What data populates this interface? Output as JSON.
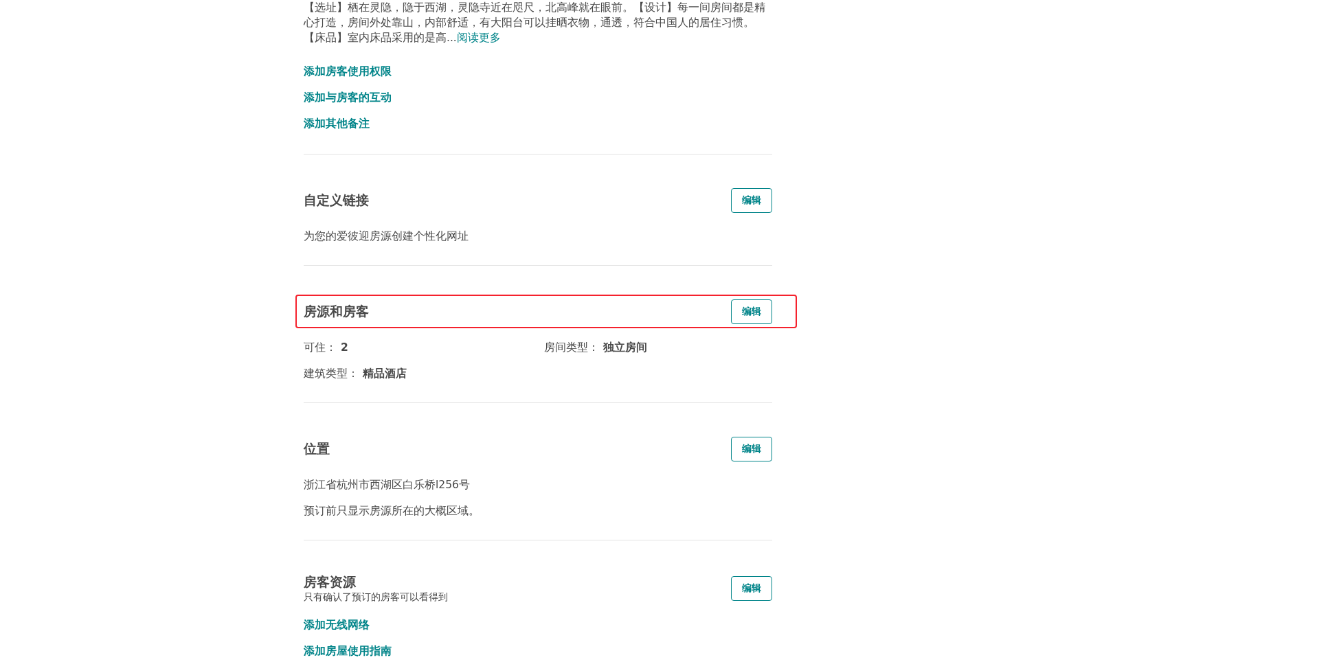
{
  "intro": {
    "paragraph": "【选址】栖在灵隐，隐于西湖，灵隐寺近在咫尺，北高峰就在眼前。【设计】每一间房间都是精心打造，房间外处靠山，内部舒适，有大阳台可以挂晒衣物，通透，符合中国人的居住习惯。【床品】室内床品采用的是高...",
    "read_more": "阅读更多",
    "links": [
      "添加房客使用权限",
      "添加与房客的互动",
      "添加其他备注"
    ]
  },
  "sections": [
    {
      "title": "自定义链接",
      "button": "编辑",
      "body": [
        {
          "kind": "text",
          "text": "为您的爱彼迎房源创建个性化网址"
        }
      ]
    },
    {
      "title": "房源和房客",
      "button": "编辑",
      "highlighted": true,
      "body": [
        {
          "kind": "fields",
          "fields": [
            {
              "label": "可住：",
              "value": "2"
            },
            {
              "label": "房间类型：",
              "value": "独立房间"
            },
            {
              "label": "建筑类型：",
              "value": "精品酒店"
            }
          ]
        }
      ]
    },
    {
      "title": "位置",
      "button": "编辑",
      "body": [
        {
          "kind": "text",
          "text": "浙江省杭州市西湖区白乐桥l256号"
        },
        {
          "kind": "text",
          "text": "预订前只显示房源所在的大概区域。"
        }
      ]
    },
    {
      "title": "房客资源",
      "subtitle": "只有确认了预订的房客可以看得到",
      "button": "编辑",
      "body": [
        {
          "kind": "link",
          "text": "添加无线网络"
        },
        {
          "kind": "link",
          "text": "添加房屋使用指南"
        }
      ]
    }
  ]
}
